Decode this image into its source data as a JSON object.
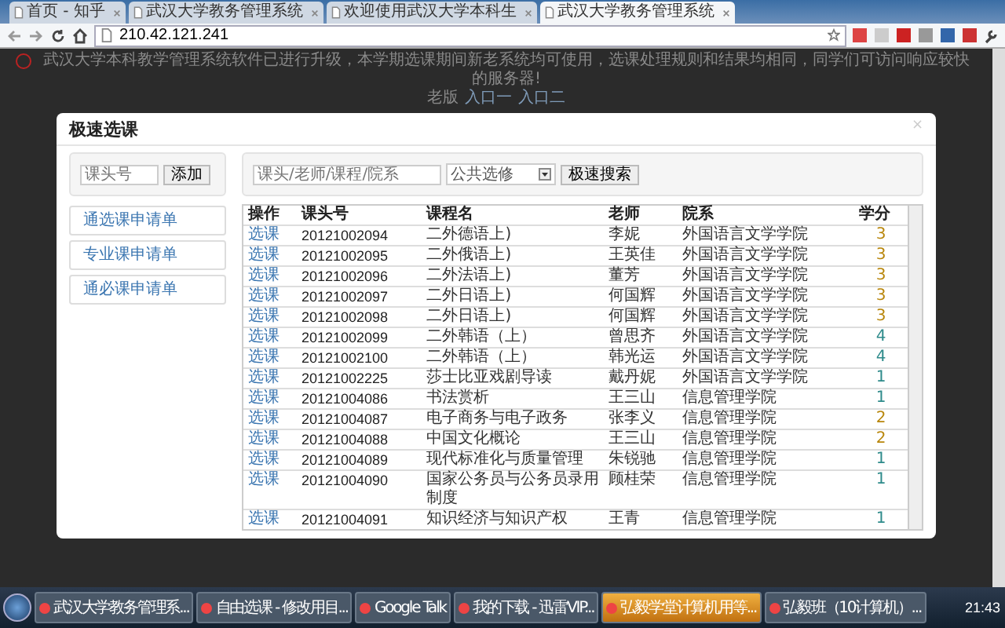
{
  "browser": {
    "tabs": [
      {
        "title": "首页 - 知乎",
        "selected": false
      },
      {
        "title": "武汉大学教务管理系统",
        "selected": false
      },
      {
        "title": "欢迎使用武汉大学本科生",
        "selected": false
      },
      {
        "title": "武汉大学教务管理系统",
        "selected": true
      }
    ],
    "address": "210.42.121.241"
  },
  "notice": {
    "text": "武汉大学本科教学管理系统软件已进行升级，本学期选课期间新老系统均可使用，选课处理规则和结果均相同，同学们可访问响应较快的服务器!",
    "links_label": "老版",
    "links": [
      "入口一",
      "入口二"
    ]
  },
  "modal": {
    "title": "极速选课",
    "close": "×",
    "add": {
      "placeholder": "课头号",
      "button": "添加"
    },
    "search": {
      "placeholder": "课头/老师/课程/院系",
      "category": "公共选修",
      "button": "极速搜索"
    },
    "menu": [
      {
        "label": "通选课申请单"
      },
      {
        "label": "专业课申请单"
      },
      {
        "label": "通必课申请单"
      }
    ],
    "table": {
      "columns": [
        "操作",
        "课头号",
        "课程名",
        "老师",
        "院系",
        "学分"
      ],
      "rows": [
        {
          "action": "选课",
          "code": "20121002094",
          "name": "二外德语上)",
          "teacher": "李妮",
          "dept": "外国语言文学学院",
          "credit": "3",
          "color": "#b8860b"
        },
        {
          "action": "选课",
          "code": "20121002095",
          "name": "二外俄语上)",
          "teacher": "王英佳",
          "dept": "外国语言文学学院",
          "credit": "3",
          "color": "#b8860b"
        },
        {
          "action": "选课",
          "code": "20121002096",
          "name": "二外法语上)",
          "teacher": "董芳",
          "dept": "外国语言文学学院",
          "credit": "3",
          "color": "#b8860b"
        },
        {
          "action": "选课",
          "code": "20121002097",
          "name": "二外日语上)",
          "teacher": "何国辉",
          "dept": "外国语言文学学院",
          "credit": "3",
          "color": "#b8860b"
        },
        {
          "action": "选课",
          "code": "20121002098",
          "name": "二外日语上)",
          "teacher": "何国辉",
          "dept": "外国语言文学学院",
          "credit": "3",
          "color": "#b8860b"
        },
        {
          "action": "选课",
          "code": "20121002099",
          "name": "二外韩语（上）",
          "teacher": "曾思齐",
          "dept": "外国语言文学学院",
          "credit": "4",
          "color": "#2e8b8b"
        },
        {
          "action": "选课",
          "code": "20121002100",
          "name": "二外韩语（上）",
          "teacher": "韩光运",
          "dept": "外国语言文学学院",
          "credit": "4",
          "color": "#2e8b8b"
        },
        {
          "action": "选课",
          "code": "20121002225",
          "name": "莎士比亚戏剧导读",
          "teacher": "戴丹妮",
          "dept": "外国语言文学学院",
          "credit": "1",
          "color": "#2e8b8b"
        },
        {
          "action": "选课",
          "code": "20121004086",
          "name": "书法赏析",
          "teacher": "王三山",
          "dept": "信息管理学院",
          "credit": "1",
          "color": "#2e8b8b"
        },
        {
          "action": "选课",
          "code": "20121004087",
          "name": "电子商务与电子政务",
          "teacher": "张李义",
          "dept": "信息管理学院",
          "credit": "2",
          "color": "#b8860b"
        },
        {
          "action": "选课",
          "code": "20121004088",
          "name": "中国文化概论",
          "teacher": "王三山",
          "dept": "信息管理学院",
          "credit": "2",
          "color": "#b8860b"
        },
        {
          "action": "选课",
          "code": "20121004089",
          "name": "现代标准化与质量管理",
          "teacher": "朱锐驰",
          "dept": "信息管理学院",
          "credit": "1",
          "color": "#2e8b8b"
        },
        {
          "action": "选课",
          "code": "20121004090",
          "name": "国家公务员与公务员录用制度",
          "teacher": "顾桂荣",
          "dept": "信息管理学院",
          "credit": "1",
          "color": "#2e8b8b"
        },
        {
          "action": "选课",
          "code": "20121004091",
          "name": "知识经济与知识产权",
          "teacher": "王青",
          "dept": "信息管理学院",
          "credit": "1",
          "color": "#2e8b8b"
        }
      ]
    }
  },
  "taskbar": {
    "items": [
      {
        "label": "武汉大学教务管理系...",
        "selected": false
      },
      {
        "label": "自由选课 - 修改用目...",
        "selected": false
      },
      {
        "label": "Google Talk",
        "selected": false
      },
      {
        "label": "我的下载 - 迅雷VIP...",
        "selected": false
      },
      {
        "label": "弘毅学堂计算机用等...",
        "selected": true
      },
      {
        "label": "弘毅班（10计算机）...",
        "selected": false
      }
    ],
    "time": "21:43"
  }
}
